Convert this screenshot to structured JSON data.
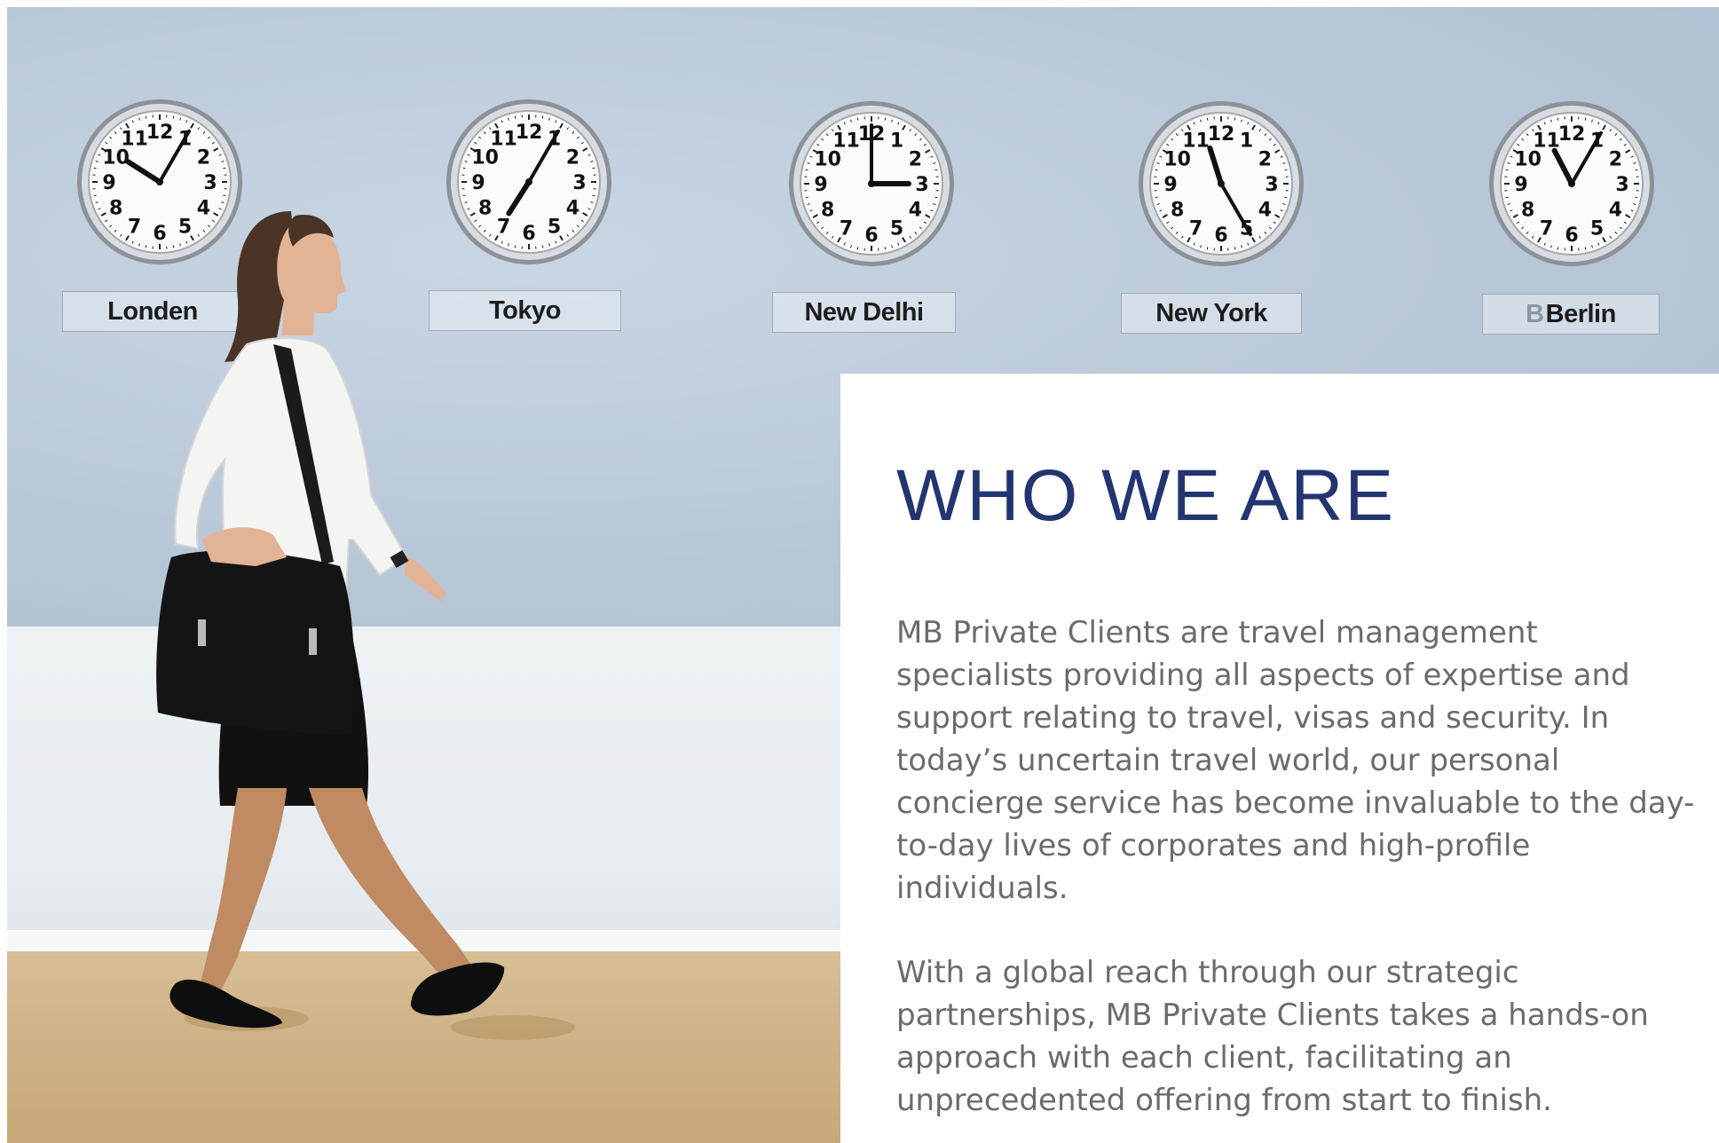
{
  "photo": {
    "clocks": [
      {
        "city": "Londen",
        "hour": 10,
        "minute": 5
      },
      {
        "city": "Tokyo",
        "hour": 7,
        "minute": 5
      },
      {
        "city": "New Delhi",
        "hour": 3,
        "minute": 0
      },
      {
        "city": "New York",
        "hour": 11,
        "minute": 25
      },
      {
        "city": "Berlin",
        "hour": 11,
        "minute": 5
      }
    ],
    "hidden_plate_text": "B"
  },
  "content": {
    "heading": "WHO WE ARE",
    "paragraph1": "MB Private Clients are travel management specialists providing all aspects of expertise and support relating to travel, visas and security. In today’s uncertain travel world, our personal concierge service has become invaluable to the day-to-day lives of corporates and high-profile individuals.",
    "paragraph2": "With a global reach through our strategic partnerships, MB Private Clients takes a hands-on approach with each client, facilitating an unprecedented offering from start to finish."
  },
  "colors": {
    "heading": "#223570",
    "body_text": "#6b6b6b",
    "wall": "#b9c8d8"
  }
}
